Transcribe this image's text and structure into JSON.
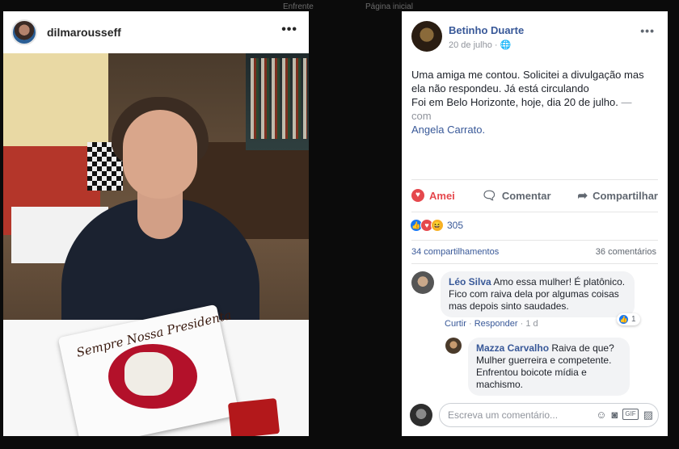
{
  "background_ui": {
    "ghost_left": "Enfrente",
    "ghost_right": "Página inicial"
  },
  "instagram": {
    "username": "dilmarousseff",
    "more": "•••",
    "plate_text": "Sempre Nossa Presidenta"
  },
  "facebook": {
    "author": "Betinho Duarte",
    "date": "20 de julho · 🌐",
    "more": "•••",
    "post_line1": "Uma amiga me contou. Solicitei a divulgação mas ela não respondeu. Já está circulando",
    "post_line2": "Foi em Belo Horizonte, hoje, dia 20 de julho.",
    "with_text": "— com",
    "tagged": "Angela Carrato.",
    "actions": {
      "loved": "Amei",
      "comment": "Comentar",
      "share": "Compartilhar"
    },
    "reactions_count": "305",
    "shares": "34 compartilhamentos",
    "comments_count": "36 comentários",
    "comments": [
      {
        "name": "Léo Silva",
        "text": "Amo essa mulher! É platônico. Fico com raiva dela por algumas coisas mas depois sinto saudades.",
        "reply": "Curtir",
        "respond": "Responder",
        "time": "1 d",
        "likes": "1"
      },
      {
        "name": "Mazza Carvalho",
        "text": "Raiva de que? Mulher guerreira e competente. Enfrentou boicote mídia e machismo."
      }
    ],
    "compose_placeholder": "Escreva um comentário...",
    "compose_gif": "GIF"
  },
  "colors": {
    "fb_link": "#385898",
    "love": "#e5484d",
    "like": "#1877f2"
  }
}
